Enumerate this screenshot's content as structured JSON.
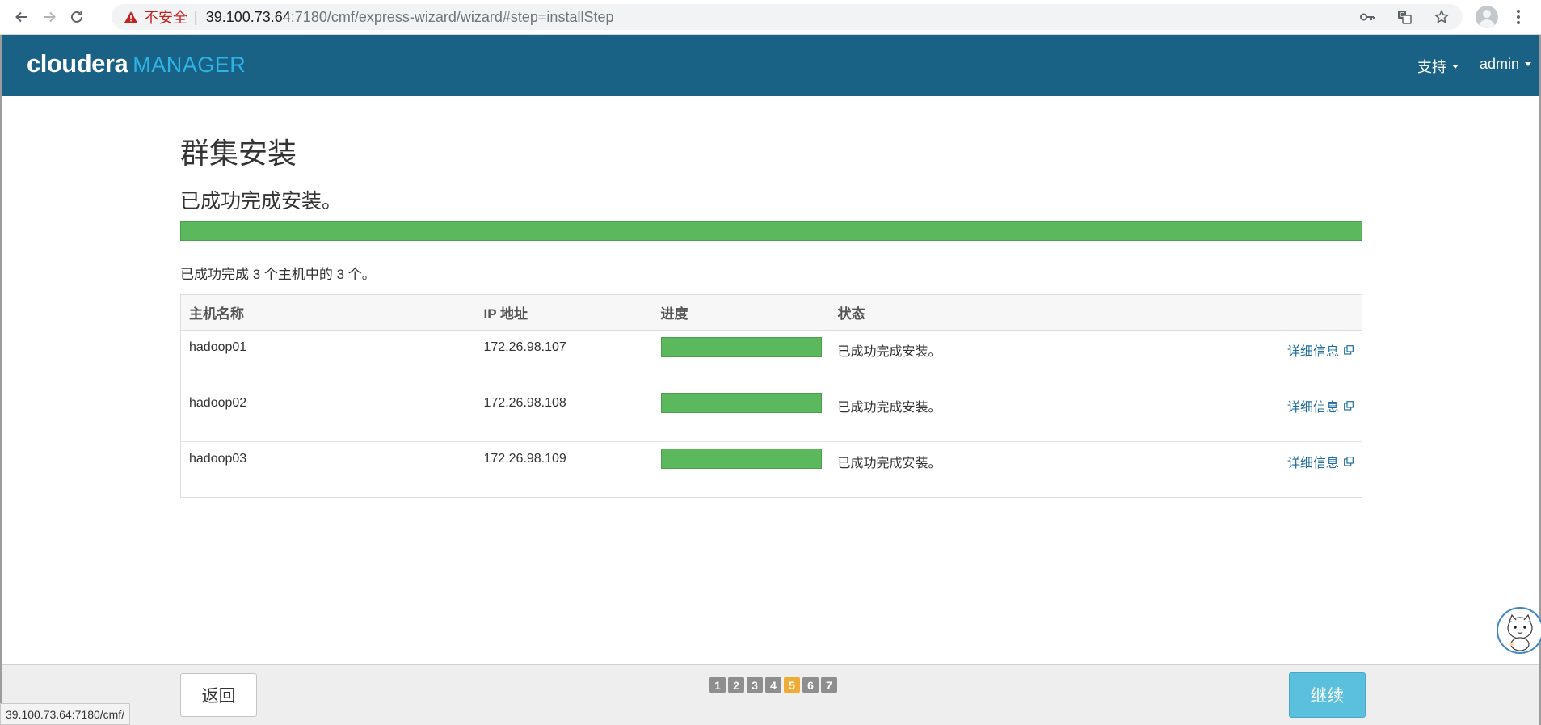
{
  "browser": {
    "security_label": "不安全",
    "separator": "|",
    "url_host": "39.100.73.64",
    "url_path": ":7180/cmf/express-wizard/wizard#step=installStep",
    "status_url": "39.100.73.64:7180/cmf/"
  },
  "header": {
    "brand": "cloudera",
    "product": "MANAGER",
    "support_label": "支持",
    "user_label": "admin"
  },
  "main": {
    "title": "群集安装",
    "status_message": "已成功完成安装。",
    "overall_progress": 1.0,
    "summary": "已成功完成 3 个主机中的 3 个。",
    "columns": [
      "主机名称",
      "IP 地址",
      "进度",
      "状态",
      ""
    ],
    "hosts": [
      {
        "name": "hadoop01",
        "ip": "172.26.98.107",
        "progress": 1.0,
        "status": "已成功完成安装。",
        "detail_label": "详细信息"
      },
      {
        "name": "hadoop02",
        "ip": "172.26.98.108",
        "progress": 1.0,
        "status": "已成功完成安装。",
        "detail_label": "详细信息"
      },
      {
        "name": "hadoop03",
        "ip": "172.26.98.109",
        "progress": 1.0,
        "status": "已成功完成安装。",
        "detail_label": "详细信息"
      }
    ]
  },
  "footer": {
    "back_label": "返回",
    "continue_label": "继续",
    "steps": [
      "1",
      "2",
      "3",
      "4",
      "5",
      "6",
      "7"
    ],
    "active_step": "5"
  },
  "colors": {
    "header_bg": "#196185",
    "brand_accent": "#2db4e6",
    "progress_green": "#5cb85c",
    "active_step": "#efac34",
    "continue_bg": "#5bc0de",
    "link": "#1d6e9f"
  }
}
